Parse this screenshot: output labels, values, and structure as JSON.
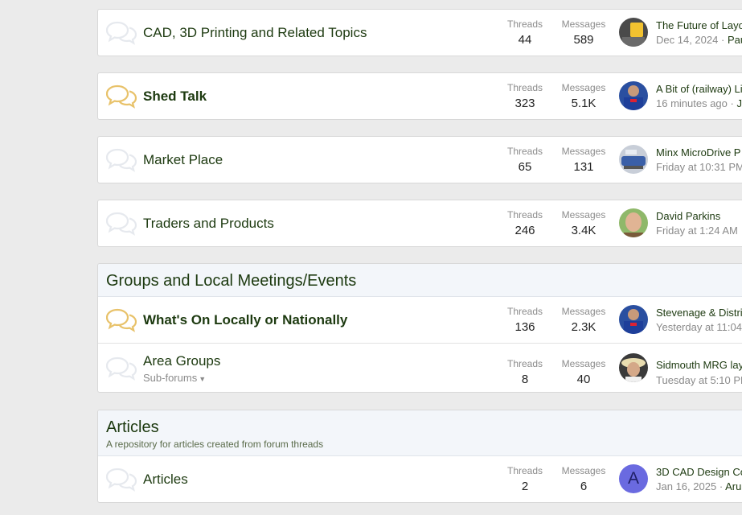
{
  "labels": {
    "threads": "Threads",
    "messages": "Messages"
  },
  "forums": {
    "cad": {
      "title": "CAD, 3D Printing and Related Topics",
      "threads": "44",
      "messages": "589",
      "latest_title": "The Future of Layo",
      "latest_date": "Dec 14, 2024",
      "latest_user": "Pau",
      "unread": false
    },
    "shed": {
      "title": "Shed Talk",
      "threads": "323",
      "messages": "5.1K",
      "latest_title": "A Bit of (railway) Li",
      "latest_date": "16 minutes ago",
      "latest_user": "J",
      "unread": true
    },
    "market": {
      "title": "Market Place",
      "threads": "65",
      "messages": "131",
      "latest_title": "Minx MicroDrive P",
      "latest_date": "Friday at 10:31 PM",
      "unread": false
    },
    "traders": {
      "title": "Traders and Products",
      "threads": "246",
      "messages": "3.4K",
      "latest_title": "David Parkins",
      "latest_date": "Friday at 1:24 AM",
      "unread": false
    },
    "whatson": {
      "title": "What's On Locally or Nationally",
      "threads": "136",
      "messages": "2.3K",
      "latest_title": "Stevenage & Distri",
      "latest_date": "Yesterday at 11:04",
      "unread": true
    },
    "area": {
      "title": "Area Groups",
      "subforums": "Sub-forums",
      "threads": "8",
      "messages": "40",
      "latest_title": "Sidmouth MRG lay",
      "latest_date": "Tuesday at 5:10 PM",
      "unread": false
    },
    "articles": {
      "title": "Articles",
      "threads": "2",
      "messages": "6",
      "latest_title": "3D CAD Design Co",
      "latest_date": "Jan 16, 2025",
      "latest_user": "Arun",
      "avatar_letter": "A",
      "unread": false
    }
  },
  "categories": {
    "groups": {
      "title": "Groups and Local Meetings/Events"
    },
    "articles": {
      "title": "Articles",
      "description": "A repository for articles created from forum threads"
    }
  },
  "separator": "·",
  "colors": {
    "unread_icon": "#e8c26a",
    "read_icon": "#e6e9ee",
    "link": "#1d3a10"
  },
  "icons": {
    "forum": "chat-bubbles-icon",
    "subforum_caret": "caret-down-icon"
  }
}
